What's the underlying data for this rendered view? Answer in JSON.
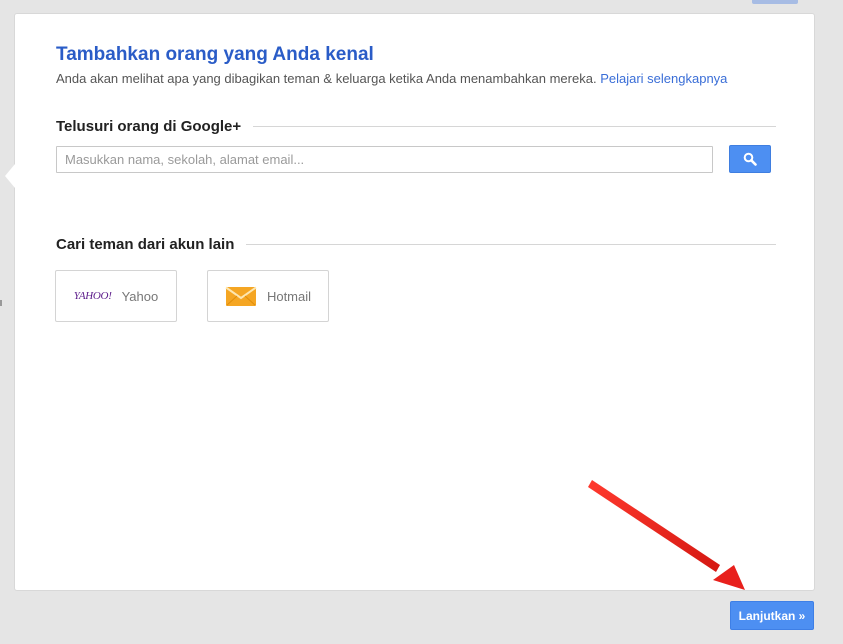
{
  "card": {
    "title": "Tambahkan orang yang Anda kenal",
    "subtitle_text": "Anda akan melihat apa yang dibagikan teman & keluarga ketika Anda menambahkan mereka.",
    "learn_more_link": "Pelajari selengkapnya"
  },
  "search_section": {
    "heading": "Telusuri orang di Google+",
    "input_placeholder": "Masukkan nama, sekolah, alamat email...",
    "input_value": "",
    "button_icon": "search-icon"
  },
  "other_accounts": {
    "heading": "Cari teman dari akun lain",
    "providers": [
      {
        "logo_text": "YAHOO!",
        "name": "Yahoo",
        "icon": "yahoo-logo"
      },
      {
        "name": "Hotmail",
        "icon": "envelope-icon"
      }
    ]
  },
  "footer": {
    "continue_label": "Lanjutkan »"
  },
  "colors": {
    "accent": "#4d8ff2",
    "title": "#2a5cc7",
    "link": "#3a6ed7",
    "annotation_arrow": "#e8201c",
    "hotmail_envelope": "#f5a623"
  }
}
